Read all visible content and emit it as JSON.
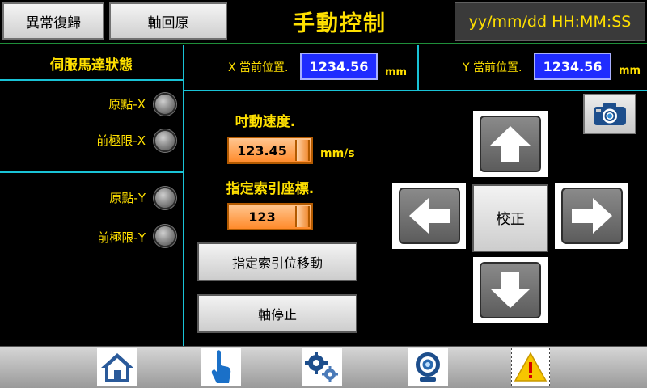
{
  "header": {
    "alarm_reset_label": "異常復歸",
    "home_axis_label": "軸回原",
    "title": "手動控制",
    "clock": "yy/mm/dd  HH:MM:SS"
  },
  "servo_panel": {
    "title": "伺服馬達狀態",
    "x_origin": "原點-X",
    "x_front_limit": "前極限-X",
    "y_origin": "原點-Y",
    "y_front_limit": "前極限-Y"
  },
  "position": {
    "x_label": "X 當前位置.",
    "x_value": "1234.56",
    "x_unit": "mm",
    "y_label": "Y 當前位置.",
    "y_value": "1234.56",
    "y_unit": "mm"
  },
  "jog": {
    "speed_label": "吋動速度.",
    "speed_value": "123.45",
    "speed_unit": "mm/s",
    "index_label": "指定索引座標.",
    "index_value": "123",
    "move_to_index_label": "指定索引位移動",
    "stop_axis_label": "軸停止",
    "calibrate_label": "校正"
  },
  "nav": {
    "items": [
      "home-icon",
      "hand-pointer-icon",
      "gears-icon",
      "webcam-icon",
      "warning-icon"
    ]
  }
}
